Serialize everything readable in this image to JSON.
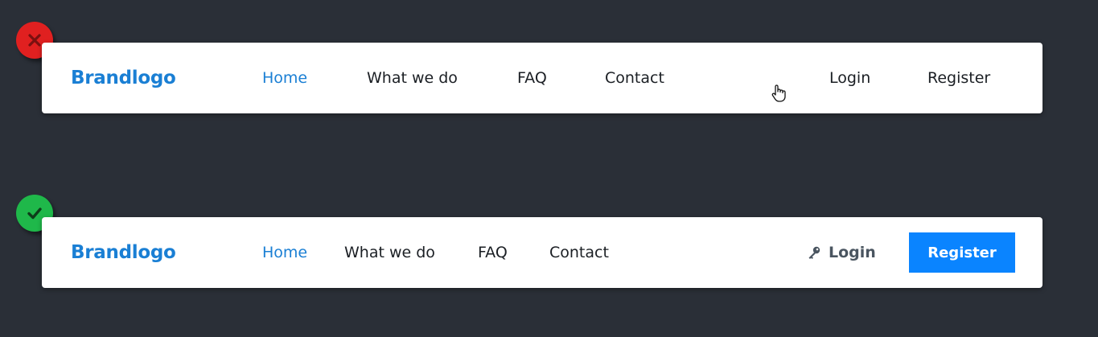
{
  "colors": {
    "background": "#2a2f37",
    "brand": "#1a7fd4",
    "active_link": "#1a7fd4",
    "link": "#1b1f24",
    "login_good": "#4a5560",
    "register_button": "#0a84ff",
    "bad_badge": "#e02020",
    "good_badge": "#1fb84a"
  },
  "bad_example": {
    "badge_icon": "close-icon",
    "brand": "Brandlogo",
    "links": [
      "Home",
      "What we do",
      "FAQ",
      "Contact"
    ],
    "login": "Login",
    "register": "Register",
    "cursor_icon": "hand-pointer-icon"
  },
  "good_example": {
    "badge_icon": "check-icon",
    "brand": "Brandlogo",
    "links": [
      "Home",
      "What we do",
      "FAQ",
      "Contact"
    ],
    "login_icon": "key-icon",
    "login": "Login",
    "register": "Register"
  }
}
